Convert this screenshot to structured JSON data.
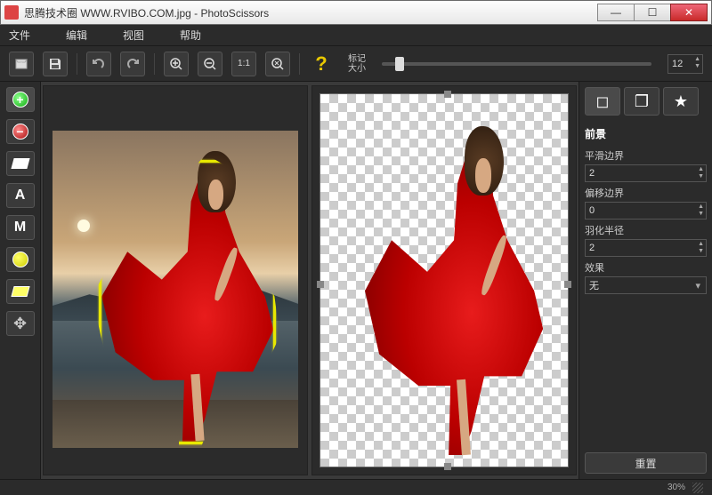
{
  "window": {
    "title": "思腾技术圈 WWW.RVIBO.COM.jpg - PhotoScissors"
  },
  "menu": {
    "file": "文件",
    "edit": "编辑",
    "view": "视图",
    "help": "帮助"
  },
  "toolbar": {
    "marker_label_line1": "标记",
    "marker_label_line2": "大小",
    "marker_size": "12"
  },
  "sidebar": {
    "letter_a": "A",
    "letter_m": "M"
  },
  "settings": {
    "section_title": "前景",
    "smooth_label": "平滑边界",
    "smooth_value": "2",
    "offset_label": "偏移边界",
    "offset_value": "0",
    "feather_label": "羽化半径",
    "feather_value": "2",
    "effect_label": "效果",
    "effect_value": "无",
    "reset_label": "重置"
  },
  "status": {
    "zoom": "30%"
  }
}
